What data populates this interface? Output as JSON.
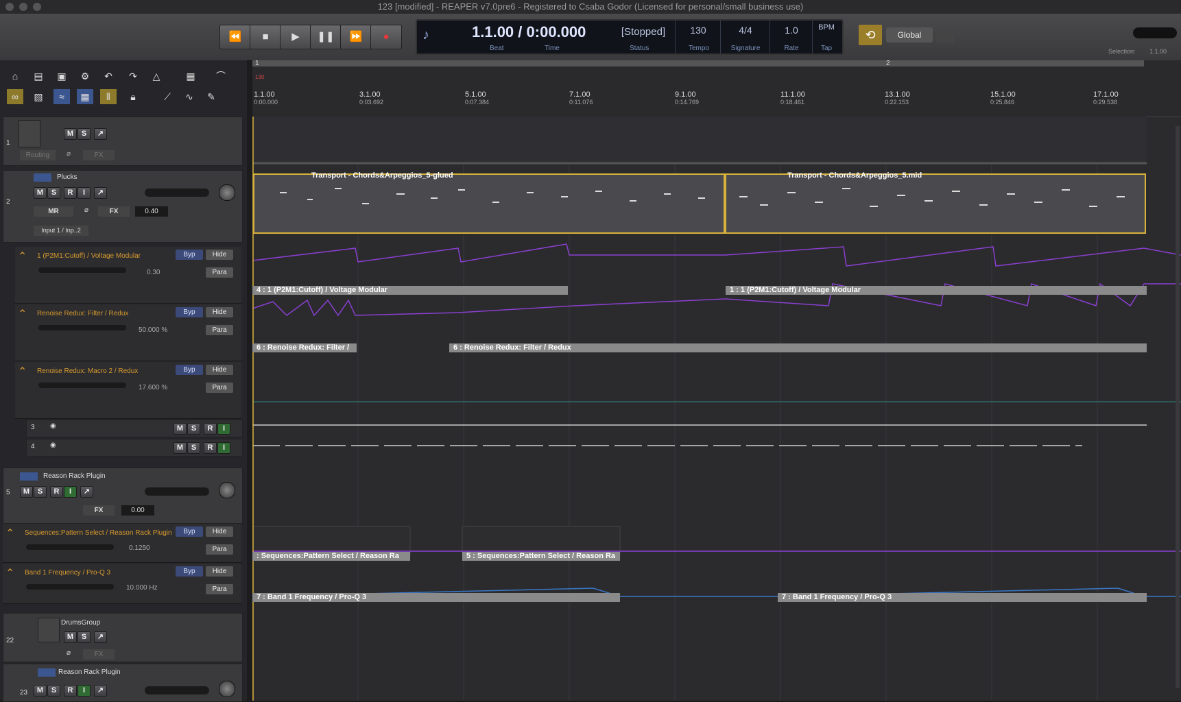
{
  "window": {
    "title": "123 [modified] - REAPER v7.0pre6 - Registered to Csaba Godor (Licensed for personal/small business use)"
  },
  "transport": {
    "position_beat": "1.1.00",
    "position_time": "0:00.000",
    "status": "[Stopped]",
    "tempo": "130",
    "signature": "4/4",
    "rate": "1.0",
    "bpm_label": "BPM",
    "labels": {
      "beat": "Beat",
      "time": "Time",
      "status": "Status",
      "tempo": "Tempo",
      "signature": "Signature",
      "rate": "Rate",
      "tap": "Tap"
    },
    "global_label": "Global",
    "selection_label": "Selection:",
    "selection_value": "1.1.00"
  },
  "ruler": {
    "regions": [
      "1",
      "2"
    ],
    "tempo_marker": "130",
    "markers": [
      {
        "beat": "1.1.00",
        "time": "0:00.000"
      },
      {
        "beat": "3.1.00",
        "time": "0:03.692"
      },
      {
        "beat": "5.1.00",
        "time": "0:07.384"
      },
      {
        "beat": "7.1.00",
        "time": "0:11.076"
      },
      {
        "beat": "9.1.00",
        "time": "0:14.769"
      },
      {
        "beat": "11.1.00",
        "time": "0:18.461"
      },
      {
        "beat": "13.1.00",
        "time": "0:22.153"
      },
      {
        "beat": "15.1.00",
        "time": "0:25.846"
      },
      {
        "beat": "17.1.00",
        "time": "0:29.538"
      }
    ]
  },
  "tracks": {
    "t1": {
      "num": "1",
      "routing": "Routing",
      "fx": "FX"
    },
    "t2": {
      "num": "2",
      "name": "Plucks",
      "volume": "0.40",
      "input": "Input 1 / Inp..2",
      "fx": "FX",
      "mrs": "MR"
    },
    "env1": {
      "name": "1 (P2M1:Cutoff) / Voltage Modular",
      "value": "0.30"
    },
    "env2": {
      "name": "Renoise Redux: Filter / Redux",
      "value": "50.000 %"
    },
    "env3": {
      "name": "Renoise Redux: Macro 2 / Redux",
      "value": "17.600 %"
    },
    "t3": {
      "num": "3"
    },
    "t4": {
      "num": "4"
    },
    "t5": {
      "num": "5",
      "name": "Reason Rack Plugin",
      "volume": "0.00",
      "fx": "FX"
    },
    "env5a": {
      "name": "Sequences:Pattern Select / Reason Rack Plugin",
      "value": "0.1250"
    },
    "env5b": {
      "name": "Band 1 Frequency / Pro-Q 3",
      "value": "10.000 Hz"
    },
    "t22": {
      "num": "22",
      "name": "DrumsGroup",
      "fx": "FX"
    },
    "t23": {
      "num": "23",
      "name": "Reason Rack Plugin"
    }
  },
  "buttons": {
    "m": "M",
    "s": "S",
    "r": "R",
    "i": "I",
    "byp": "Byp",
    "hide": "Hide",
    "para": "Para"
  },
  "items": {
    "midi1": "Transport - Chords&Arpeggios_5-glued",
    "midi2": "Transport - Chords&Arpeggios_5.mid",
    "env_a1": "4 : 1 (P2M1:Cutoff) / Voltage Modular",
    "env_a2": "1 : 1 (P2M1:Cutoff) / Voltage Modular",
    "env_b1": "6 : Renoise Redux: Filter /",
    "env_b2": "6 : Renoise Redux: Filter / Redux",
    "env_c1": ": Sequences:Pattern Select / Reason Ra",
    "env_c2": "5 : Sequences:Pattern Select / Reason Ra",
    "env_d1": "7 : Band 1 Frequency / Pro-Q 3",
    "env_d2": "7 : Band 1 Frequency / Pro-Q 3"
  },
  "colors": {
    "accent": "#d8b23a",
    "envelope": "#8a3fd0",
    "freq_env": "#3a78c8"
  }
}
